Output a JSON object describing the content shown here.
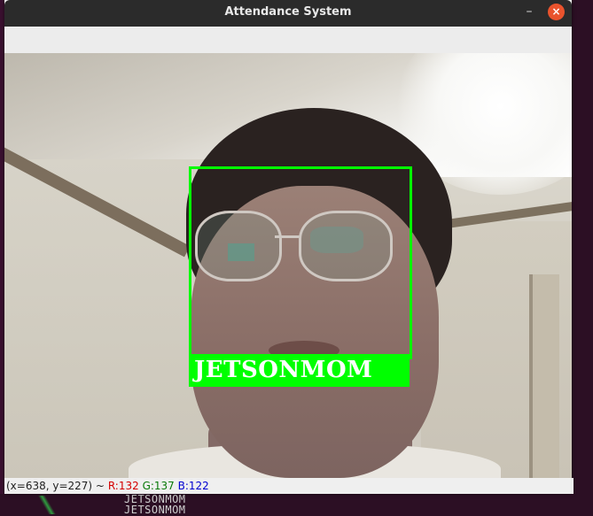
{
  "window": {
    "title": "Attendance System",
    "minimize_glyph": "–",
    "close_glyph": "×"
  },
  "detection": {
    "name_label": "JETSONMOM",
    "box_color": "#00ff00",
    "label_text_color": "#ffffff"
  },
  "statusbar": {
    "coords": "(x=638, y=227) ~",
    "r_label": "R:132",
    "g_label": "G:137",
    "b_label": "B:122"
  },
  "background_terminal": {
    "line1": "JETSONMOM",
    "line2": "JETSONMOM"
  },
  "colors": {
    "titlebar_bg": "#2b2b2b",
    "close_button": "#e9532d",
    "desktop_bg": "#2c0f24"
  }
}
